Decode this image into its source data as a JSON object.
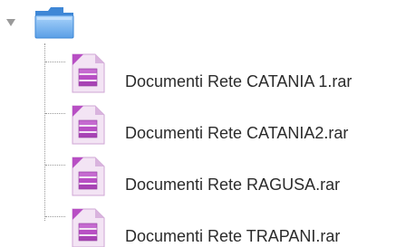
{
  "tree": {
    "folder_icon": "folder-icon",
    "toggle_icon": "triangle-down-icon",
    "files": [
      {
        "name": "Documenti Rete CATANIA 1.rar",
        "icon": "archive-file-icon"
      },
      {
        "name": "Documenti Rete CATANIA2.rar",
        "icon": "archive-file-icon"
      },
      {
        "name": "Documenti Rete RAGUSA.rar",
        "icon": "archive-file-icon"
      },
      {
        "name": "Documenti Rete TRAPANI.rar",
        "icon": "archive-file-icon"
      }
    ]
  },
  "colors": {
    "folder_light": "#8fc4f5",
    "folder_dark": "#3e87d6",
    "archive_purple": "#b84fc4",
    "archive_light": "#e9d4ec",
    "text": "#2b2b2b",
    "tree_line": "#9a9a9a"
  }
}
